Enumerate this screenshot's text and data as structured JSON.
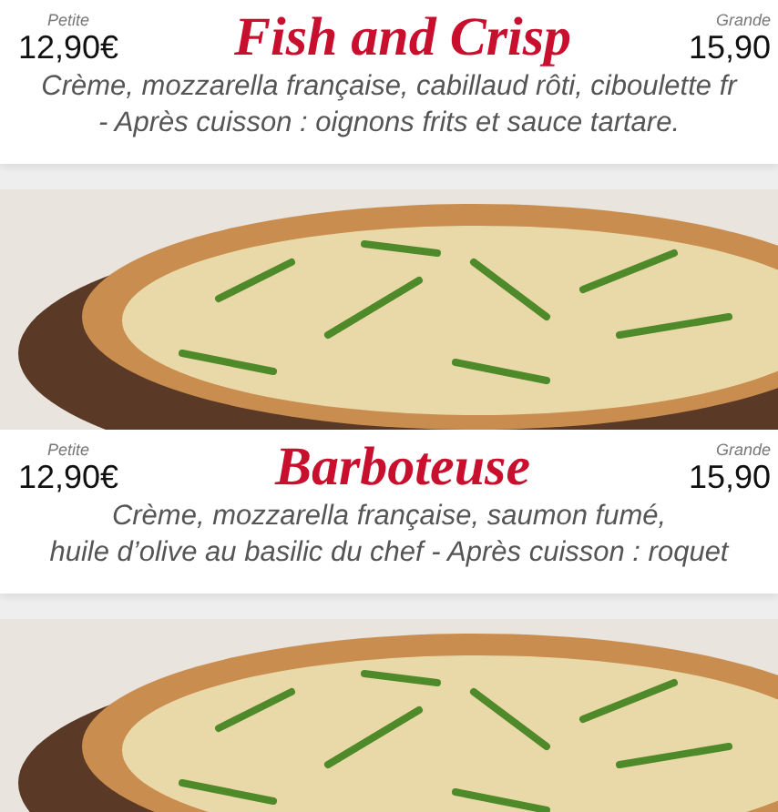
{
  "blocks": [
    {
      "kind": "info",
      "name": "Fish and Crisp",
      "small": {
        "label": "Petite",
        "price": "12,90€"
      },
      "large": {
        "label": "Grande",
        "price": "15,90"
      },
      "description": [
        "Crème, mozzarella française, cabillaud rôti, ciboulette fr",
        "- Après cuisson : oignons frits et sauce tartare."
      ]
    },
    {
      "kind": "photo"
    },
    {
      "kind": "info",
      "name": "Barboteuse",
      "small": {
        "label": "Petite",
        "price": "12,90€"
      },
      "large": {
        "label": "Grande",
        "price": "15,90"
      },
      "description": [
        "Crème, mozzarella française, saumon fumé,",
        "huile d’olive au basilic du chef - Après cuisson : roquet"
      ]
    },
    {
      "kind": "photo"
    }
  ]
}
